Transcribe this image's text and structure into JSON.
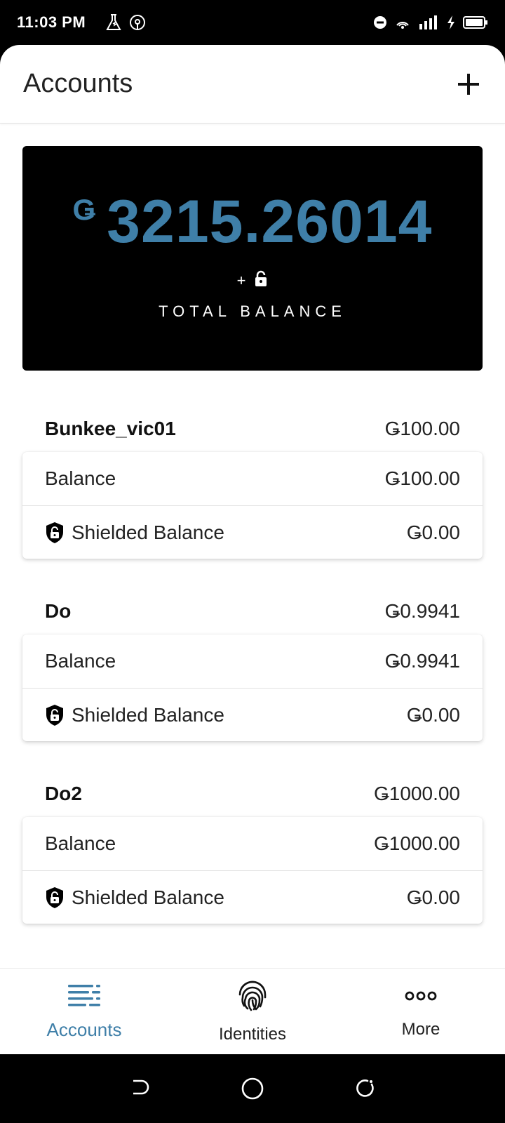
{
  "status_bar": {
    "time": "11:03 PM"
  },
  "header": {
    "title": "Accounts"
  },
  "total": {
    "currency": "Ǥ",
    "amount": "3215.26014",
    "plus": "+",
    "label": "TOTAL BALANCE"
  },
  "accounts": [
    {
      "name": "Bunkee_vic01",
      "total": "Ǥ100.00",
      "balance_label": "Balance",
      "balance": "Ǥ100.00",
      "shielded_label": "Shielded Balance",
      "shielded": "Ǥ0.00"
    },
    {
      "name": "Do",
      "total": "Ǥ0.9941",
      "balance_label": "Balance",
      "balance": "Ǥ0.9941",
      "shielded_label": "Shielded Balance",
      "shielded": "Ǥ0.00"
    },
    {
      "name": "Do2",
      "total": "Ǥ1000.00",
      "balance_label": "Balance",
      "balance": "Ǥ1000.00",
      "shielded_label": "Shielded Balance",
      "shielded": "Ǥ0.00"
    }
  ],
  "bottom_nav": {
    "items": [
      {
        "label": "Accounts",
        "icon": "accounts-list-icon",
        "active": true
      },
      {
        "label": "Identities",
        "icon": "fingerprint-icon",
        "active": false
      },
      {
        "label": "More",
        "icon": "more-dots-icon",
        "active": false
      }
    ]
  },
  "colors": {
    "accent": "#3f7fa8",
    "card_bg": "#000000"
  }
}
